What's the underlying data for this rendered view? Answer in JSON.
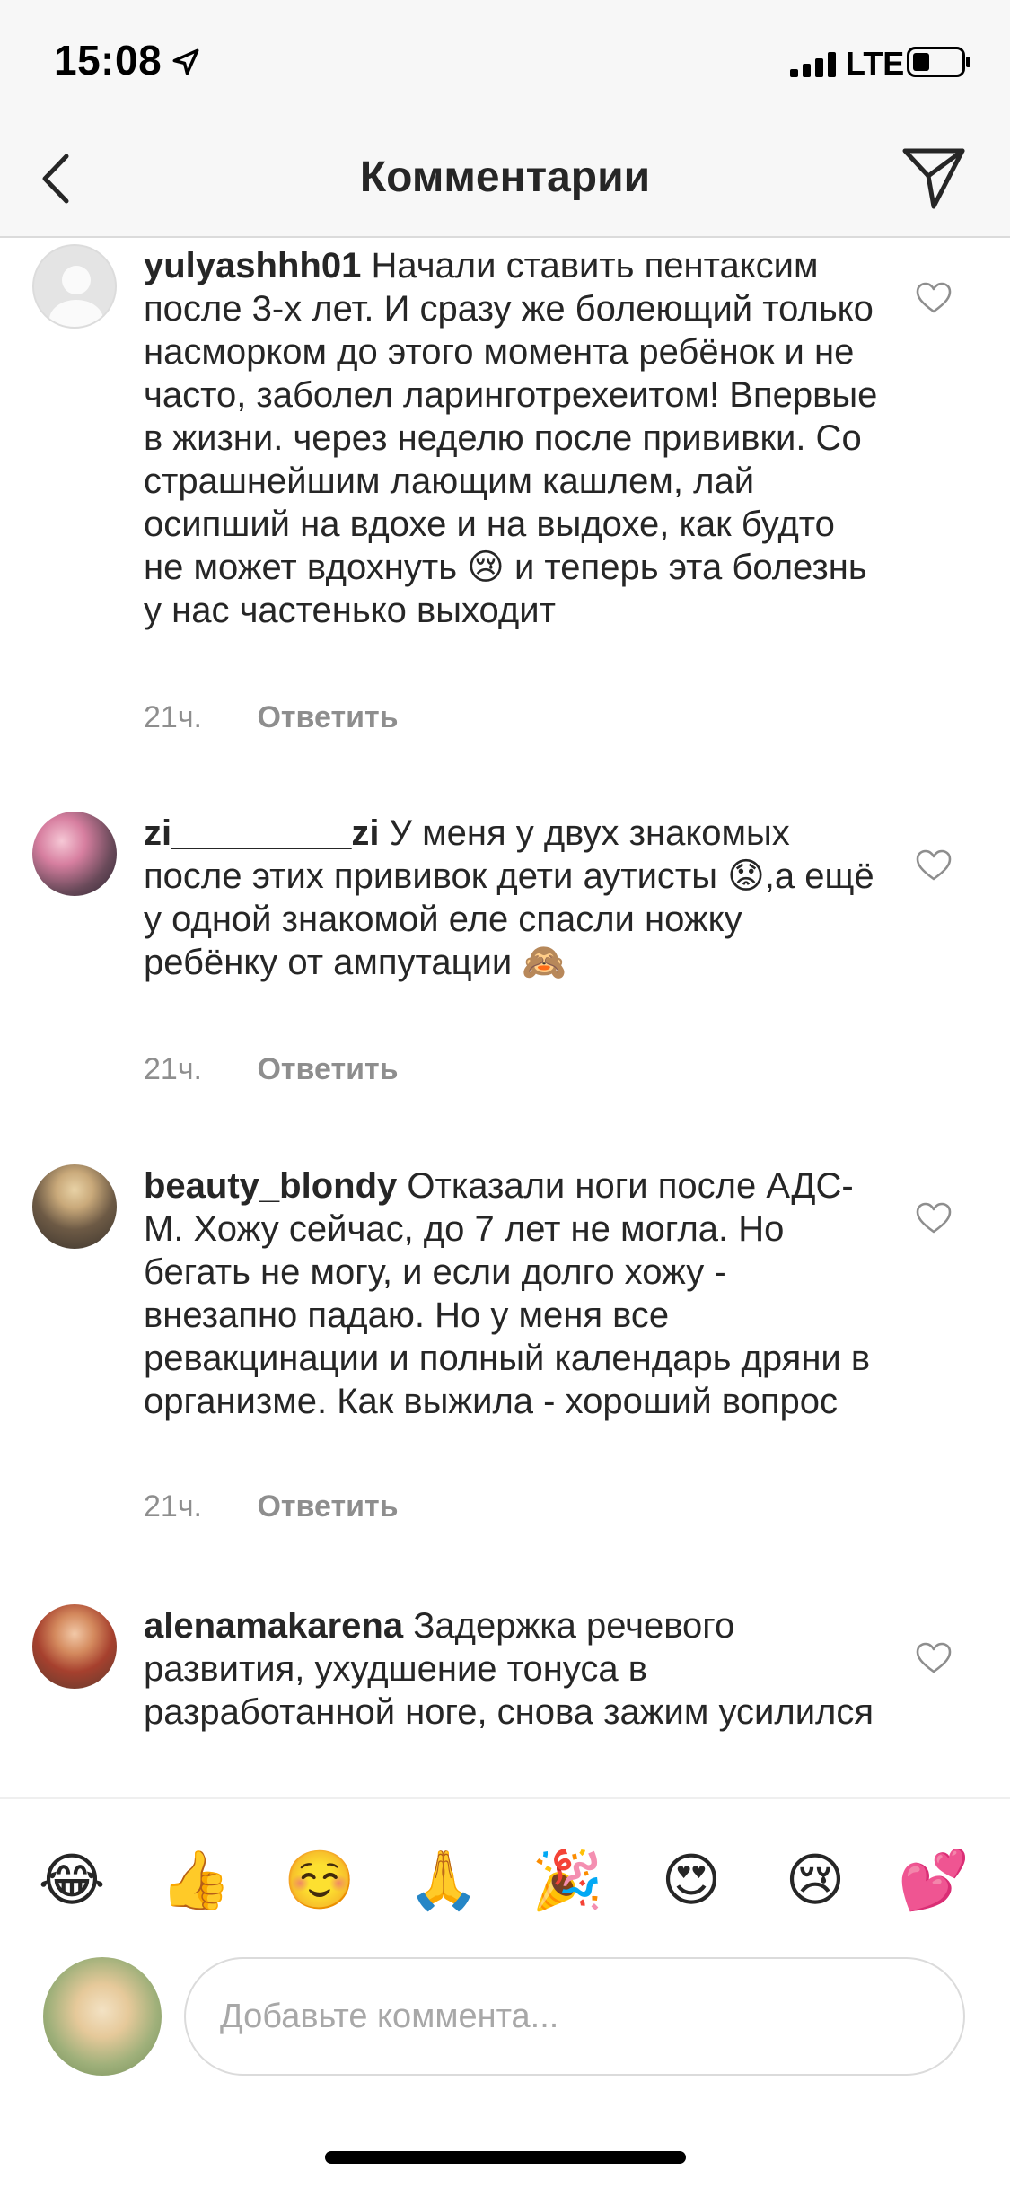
{
  "status_bar": {
    "time": "15:08",
    "network": "LTE"
  },
  "nav": {
    "title": "Комментарии"
  },
  "comments": [
    {
      "username": "yulyashhh01",
      "text": "Начали ставить пентаксим после 3-х лет. И сразу же болеющий только насморком до этого момента ребёнок и не часто, заболел ларинготрехеитом! Впервые в жизни. через неделю после прививки. Со страшнейшим лающим кашлем, лай осипший на вдохе и на выдохе, как будто не может вдохнуть 😢 и теперь эта болезнь у нас частенько выходит",
      "time": "21ч.",
      "reply_label": "Ответить"
    },
    {
      "username": "zi_________zi",
      "text": "У меня у двух знакомых после этих прививок дети аутисты 😟,а ещё у одной знакомой еле спасли ножку ребёнку от ампутации 🙈",
      "time": "21ч.",
      "reply_label": "Ответить"
    },
    {
      "username": "beauty_blondy",
      "text": "Отказали ноги после АДС-М. Хожу сейчас, до 7 лет не могла. Но бегать не могу, и если долго хожу - внезапно падаю. Но у меня все ревакцинации и полный календарь дряни в организме. Как выжила - хороший вопрос",
      "time": "21ч.",
      "reply_label": "Ответить"
    },
    {
      "username": "alenamakarena",
      "text": "Задержка речевого развития, ухудшение тонуса в разработанной ноге, снова зажим усилился"
    }
  ],
  "emoji_bar": [
    "😂",
    "👍",
    "☺️",
    "🙏",
    "🎉",
    "😍",
    "😢",
    "💕"
  ],
  "input": {
    "placeholder": "Добавьте коммента..."
  },
  "icons": {
    "back": "chevron-left-icon",
    "send": "paper-plane-icon",
    "like": "heart-outline-icon"
  }
}
